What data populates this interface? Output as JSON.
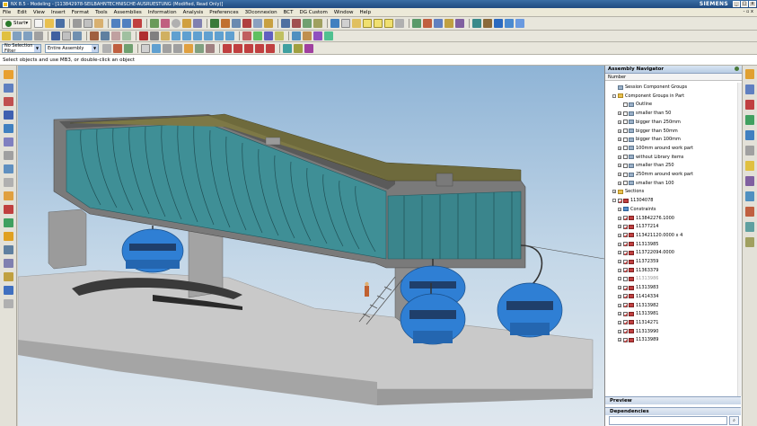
{
  "window": {
    "title": "NX 8.5 - Modeling - [113842978-SEILBAHNTECHNISCHE-AUSRUESTUNG (Modified, Read Only)]",
    "brand": "SIEMENS",
    "buttons": [
      "_",
      "□",
      "x"
    ]
  },
  "menubar": {
    "items": [
      "File",
      "Edit",
      "View",
      "Insert",
      "Format",
      "Tools",
      "Assemblies",
      "Information",
      "Analysis",
      "Preferences",
      "3Dconnexion",
      "BCT",
      "DG Custom",
      "Window",
      "Help"
    ],
    "right": "- ▫ x"
  },
  "toolbar": {
    "start_label": "Start▾",
    "selection_filter": "No Selection Filter",
    "scope": "Entire Assembly"
  },
  "cue_line": "Select objects and use MB3, or double-click an object",
  "assembly_navigator": {
    "title": "Assembly Navigator",
    "column_header": "Number",
    "tree": [
      {
        "label": "Session Component Groups",
        "indent": 1,
        "icon": "grp",
        "check": "none",
        "exp": ""
      },
      {
        "label": "Component Groups in Part",
        "indent": 1,
        "icon": "folder",
        "check": "none",
        "exp": "-"
      },
      {
        "label": "Outline",
        "indent": 2,
        "icon": "grp",
        "check": "empty",
        "exp": ""
      },
      {
        "label": "smaller than 50",
        "indent": 2,
        "icon": "grp",
        "check": "empty",
        "exp": "+"
      },
      {
        "label": "bigger than 250mm",
        "indent": 2,
        "icon": "grp",
        "check": "empty",
        "exp": "+"
      },
      {
        "label": "bigger than 50mm",
        "indent": 2,
        "icon": "grp",
        "check": "empty",
        "exp": "+"
      },
      {
        "label": "bigger than 100mm",
        "indent": 2,
        "icon": "grp",
        "check": "empty",
        "exp": "+"
      },
      {
        "label": "100mm around work part",
        "indent": 2,
        "icon": "grp",
        "check": "empty",
        "exp": "+"
      },
      {
        "label": "without Library items",
        "indent": 2,
        "icon": "grp",
        "check": "empty",
        "exp": "+"
      },
      {
        "label": "smaller than 250",
        "indent": 2,
        "icon": "grp",
        "check": "empty",
        "exp": "+"
      },
      {
        "label": "250mm around work part",
        "indent": 2,
        "icon": "grp",
        "check": "empty",
        "exp": "+"
      },
      {
        "label": "smaller than 100",
        "indent": 2,
        "icon": "grp",
        "check": "empty",
        "exp": "+"
      },
      {
        "label": "Sections",
        "indent": 1,
        "icon": "folder",
        "check": "none",
        "exp": "+"
      },
      {
        "label": "11304078",
        "indent": 1,
        "icon": "part",
        "check": "on",
        "exp": "-"
      },
      {
        "label": "Constraints",
        "indent": 2,
        "icon": "cons",
        "check": "none",
        "exp": "+"
      },
      {
        "label": "113842276.1000",
        "indent": 2,
        "icon": "part",
        "check": "on",
        "exp": "+"
      },
      {
        "label": "11377214",
        "indent": 2,
        "icon": "part",
        "check": "on",
        "exp": "+"
      },
      {
        "label": "113421120.0000 x 4",
        "indent": 2,
        "icon": "part",
        "check": "on",
        "exp": "+"
      },
      {
        "label": "11313985",
        "indent": 2,
        "icon": "part",
        "check": "on",
        "exp": "+"
      },
      {
        "label": "113722094.0000",
        "indent": 2,
        "icon": "part",
        "check": "on",
        "exp": "+"
      },
      {
        "label": "11372359",
        "indent": 2,
        "icon": "part",
        "check": "on",
        "exp": "+"
      },
      {
        "label": "11363379",
        "indent": 2,
        "icon": "part",
        "check": "on",
        "exp": "+"
      },
      {
        "label": "11313986",
        "indent": 2,
        "icon": "part",
        "check": "empty",
        "exp": "+",
        "dim": true
      },
      {
        "label": "11313983",
        "indent": 2,
        "icon": "part",
        "check": "on",
        "exp": "+"
      },
      {
        "label": "11414334",
        "indent": 2,
        "icon": "part",
        "check": "on",
        "exp": "+"
      },
      {
        "label": "11313982",
        "indent": 2,
        "icon": "part",
        "check": "on",
        "exp": "+"
      },
      {
        "label": "11313981",
        "indent": 2,
        "icon": "part",
        "check": "on",
        "exp": "+"
      },
      {
        "label": "11314271",
        "indent": 2,
        "icon": "part",
        "check": "on",
        "exp": "+"
      },
      {
        "label": "11313990",
        "indent": 2,
        "icon": "part",
        "check": "on",
        "exp": "+"
      },
      {
        "label": "11313989",
        "indent": 2,
        "icon": "part",
        "check": "on",
        "exp": "+"
      }
    ],
    "preview_label": "Preview",
    "dependencies_label": "Dependencies"
  },
  "colors": {
    "title_bar": "#204a80",
    "glass": "#3e8f96",
    "roof": "#6e6a3c",
    "cabin": "#2f7fd4",
    "steel": "#8e8e8e"
  }
}
